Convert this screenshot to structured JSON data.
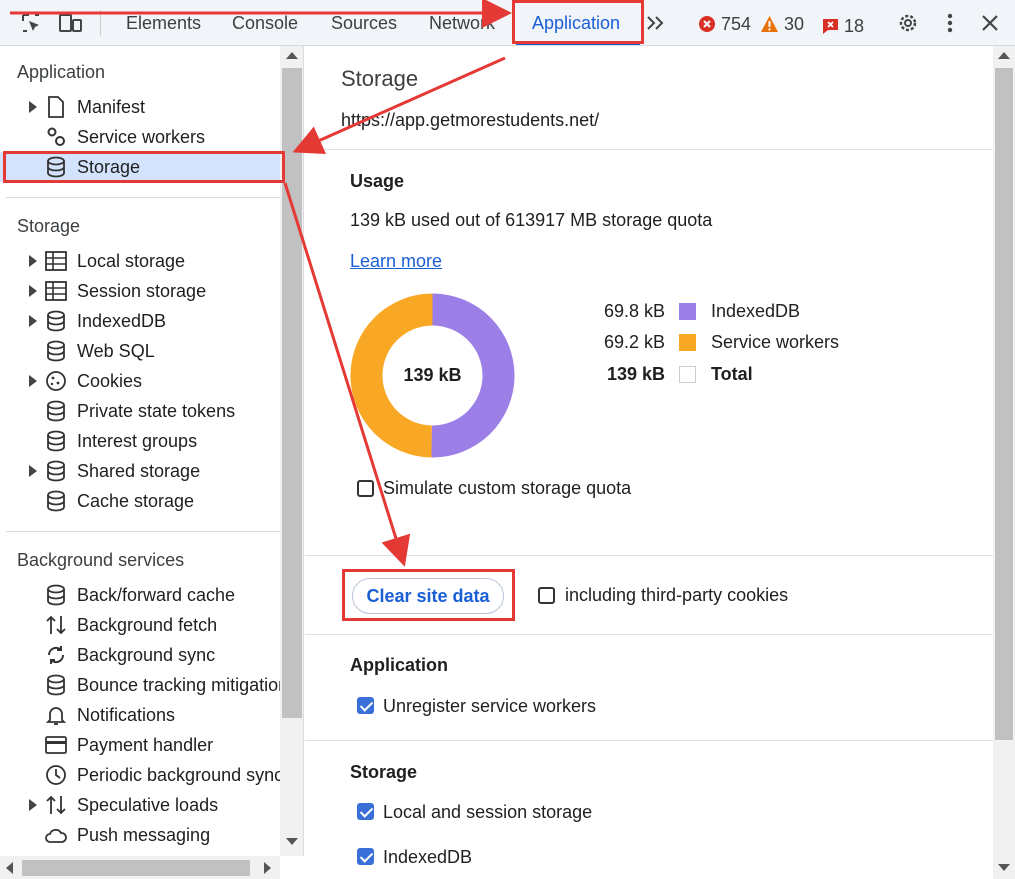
{
  "toolbar": {
    "tabs": [
      "Elements",
      "Console",
      "Sources",
      "Network",
      "Application"
    ],
    "errors": "754",
    "warnings": "30",
    "issues": "18"
  },
  "sidebar": {
    "application_heading": "Application",
    "application_items": [
      "Manifest",
      "Service workers",
      "Storage"
    ],
    "storage_heading": "Storage",
    "storage_items": [
      "Local storage",
      "Session storage",
      "IndexedDB",
      "Web SQL",
      "Cookies",
      "Private state tokens",
      "Interest groups",
      "Shared storage",
      "Cache storage"
    ],
    "background_heading": "Background services",
    "background_items": [
      "Back/forward cache",
      "Background fetch",
      "Background sync",
      "Bounce tracking mitigations",
      "Notifications",
      "Payment handler",
      "Periodic background sync",
      "Speculative loads",
      "Push messaging"
    ]
  },
  "main": {
    "title": "Storage",
    "url": "https://app.getmorestudents.net/",
    "usage_heading": "Usage",
    "usage_text": "139 kB used out of 613917 MB storage quota",
    "learn_more": "Learn more",
    "donut_center": "139 kB",
    "legend": [
      {
        "value": "69.8 kB",
        "name": "IndexedDB",
        "color": "#9b7fe6",
        "kb": 69.8
      },
      {
        "value": "69.2 kB",
        "name": "Service workers",
        "color": "#f9a825",
        "kb": 69.2
      },
      {
        "value": "139 kB",
        "name": "Total",
        "color": "#ffffff"
      }
    ],
    "simulate_label": "Simulate custom storage quota",
    "clear_button": "Clear site data",
    "third_party_label": "including third-party cookies",
    "app_heading": "Application",
    "unregister_label": "Unregister service workers",
    "storage_heading": "Storage",
    "local_session_label": "Local and session storage",
    "indexeddb_label": "IndexedDB"
  },
  "colors": {
    "accent": "#1a5fd6",
    "annotation": "#e53935",
    "indexeddb": "#9b7fe6",
    "service_workers": "#f9a825"
  }
}
